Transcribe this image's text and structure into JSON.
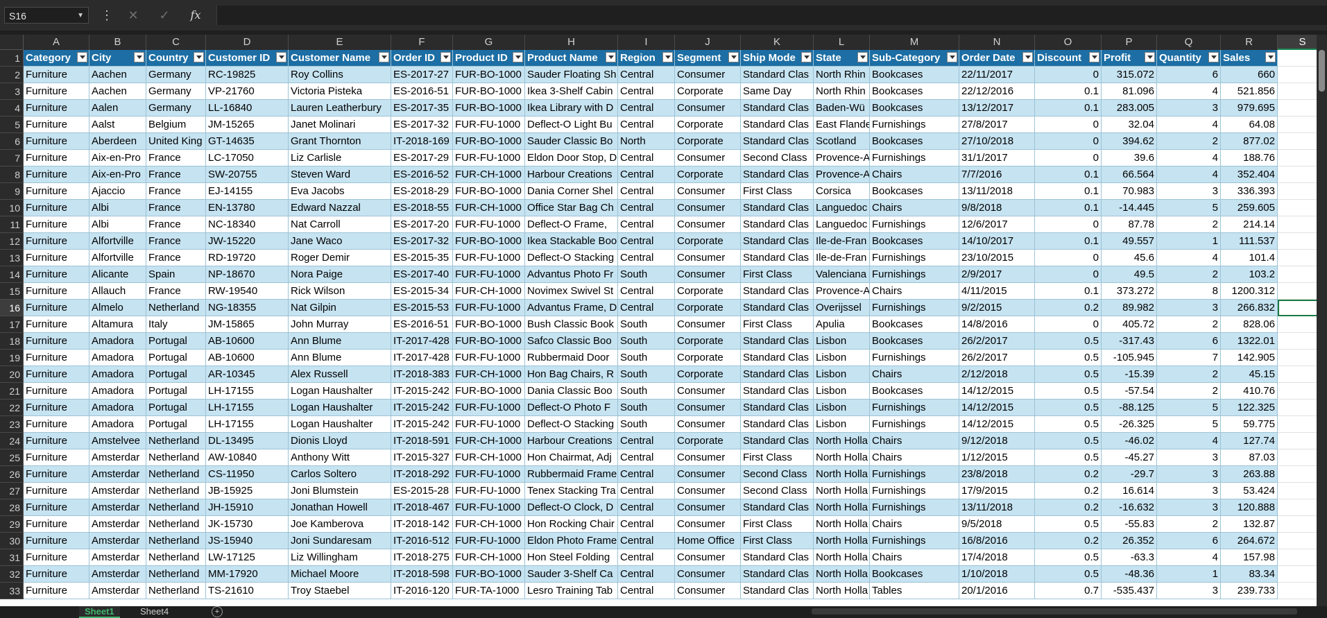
{
  "formula_bar": {
    "name_box": "S16",
    "cancel_icon": "close-icon",
    "enter_icon": "check-icon",
    "function_label": "fx",
    "formula": ""
  },
  "columns": [
    "A",
    "B",
    "C",
    "D",
    "E",
    "F",
    "G",
    "H",
    "I",
    "J",
    "K",
    "L",
    "M",
    "N",
    "O",
    "P",
    "Q",
    "R",
    "S"
  ],
  "selected_column": "S",
  "selected_row": 16,
  "headers": [
    "Category",
    "City",
    "Country",
    "Customer ID",
    "Customer Name",
    "Order ID",
    "Product ID",
    "Product Name",
    "Region",
    "Segment",
    "Ship Mode",
    "State",
    "Sub-Category",
    "Order Date",
    "Discount",
    "Profit",
    "Quantity",
    "Sales"
  ],
  "rows": [
    [
      "Furniture",
      "Aachen",
      "Germany",
      "RC-19825",
      "Roy Collins",
      "ES-2017-27",
      "FUR-BO-1000",
      "Sauder Floating Sh",
      "Central",
      "Consumer",
      "Standard Clas",
      "North Rhin",
      "Bookcases",
      "22/11/2017",
      "0",
      "315.072",
      "6",
      "660"
    ],
    [
      "Furniture",
      "Aachen",
      "Germany",
      "VP-21760",
      "Victoria Pisteka",
      "ES-2016-51",
      "FUR-BO-1000",
      "Ikea 3-Shelf Cabin",
      "Central",
      "Corporate",
      "Same Day",
      "North Rhin",
      "Bookcases",
      "22/12/2016",
      "0.1",
      "81.096",
      "4",
      "521.856"
    ],
    [
      "Furniture",
      "Aalen",
      "Germany",
      "LL-16840",
      "Lauren Leatherbury",
      "ES-2017-35",
      "FUR-BO-1000",
      "Ikea Library with D",
      "Central",
      "Consumer",
      "Standard Clas",
      "Baden-Wü",
      "Bookcases",
      "13/12/2017",
      "0.1",
      "283.005",
      "3",
      "979.695"
    ],
    [
      "Furniture",
      "Aalst",
      "Belgium",
      "JM-15265",
      "Janet Molinari",
      "ES-2017-32",
      "FUR-FU-1000",
      "Deflect-O Light Bu",
      "Central",
      "Corporate",
      "Standard Clas",
      "East Flande",
      "Furnishings",
      "27/8/2017",
      "0",
      "32.04",
      "4",
      "64.08"
    ],
    [
      "Furniture",
      "Aberdeen",
      "United King",
      "GT-14635",
      "Grant Thornton",
      "IT-2018-169",
      "FUR-BO-1000",
      "Sauder Classic Bo",
      "North",
      "Corporate",
      "Standard Clas",
      "Scotland",
      "Bookcases",
      "27/10/2018",
      "0",
      "394.62",
      "2",
      "877.02"
    ],
    [
      "Furniture",
      "Aix-en-Pro",
      "France",
      "LC-17050",
      "Liz Carlisle",
      "ES-2017-29",
      "FUR-FU-1000",
      "Eldon Door Stop, D",
      "Central",
      "Consumer",
      "Second Class",
      "Provence-A",
      "Furnishings",
      "31/1/2017",
      "0",
      "39.6",
      "4",
      "188.76"
    ],
    [
      "Furniture",
      "Aix-en-Pro",
      "France",
      "SW-20755",
      "Steven Ward",
      "ES-2016-52",
      "FUR-CH-1000",
      "Harbour Creations",
      "Central",
      "Corporate",
      "Standard Clas",
      "Provence-A",
      "Chairs",
      "7/7/2016",
      "0.1",
      "66.564",
      "4",
      "352.404"
    ],
    [
      "Furniture",
      "Ajaccio",
      "France",
      "EJ-14155",
      "Eva Jacobs",
      "ES-2018-29",
      "FUR-BO-1000",
      "Dania Corner Shel",
      "Central",
      "Consumer",
      "First Class",
      "Corsica",
      "Bookcases",
      "13/11/2018",
      "0.1",
      "70.983",
      "3",
      "336.393"
    ],
    [
      "Furniture",
      "Albi",
      "France",
      "EN-13780",
      "Edward Nazzal",
      "ES-2018-55",
      "FUR-CH-1000",
      "Office Star Bag Ch",
      "Central",
      "Consumer",
      "Standard Clas",
      "Languedoc",
      "Chairs",
      "9/8/2018",
      "0.1",
      "-14.445",
      "5",
      "259.605"
    ],
    [
      "Furniture",
      "Albi",
      "France",
      "NC-18340",
      "Nat Carroll",
      "ES-2017-20",
      "FUR-FU-1000",
      "Deflect-O Frame,",
      "Central",
      "Consumer",
      "Standard Clas",
      "Languedoc",
      "Furnishings",
      "12/6/2017",
      "0",
      "87.78",
      "2",
      "214.14"
    ],
    [
      "Furniture",
      "Alfortville",
      "France",
      "JW-15220",
      "Jane Waco",
      "ES-2017-32",
      "FUR-BO-1000",
      "Ikea Stackable Boo",
      "Central",
      "Corporate",
      "Standard Clas",
      "Ile-de-Fran",
      "Bookcases",
      "14/10/2017",
      "0.1",
      "49.557",
      "1",
      "111.537"
    ],
    [
      "Furniture",
      "Alfortville",
      "France",
      "RD-19720",
      "Roger Demir",
      "ES-2015-35",
      "FUR-FU-1000",
      "Deflect-O Stacking",
      "Central",
      "Consumer",
      "Standard Clas",
      "Ile-de-Fran",
      "Furnishings",
      "23/10/2015",
      "0",
      "45.6",
      "4",
      "101.4"
    ],
    [
      "Furniture",
      "Alicante",
      "Spain",
      "NP-18670",
      "Nora Paige",
      "ES-2017-40",
      "FUR-FU-1000",
      "Advantus Photo Fr",
      "South",
      "Consumer",
      "First Class",
      "Valenciana",
      "Furnishings",
      "2/9/2017",
      "0",
      "49.5",
      "2",
      "103.2"
    ],
    [
      "Furniture",
      "Allauch",
      "France",
      "RW-19540",
      "Rick Wilson",
      "ES-2015-34",
      "FUR-CH-1000",
      "Novimex Swivel St",
      "Central",
      "Corporate",
      "Standard Clas",
      "Provence-A",
      "Chairs",
      "4/11/2015",
      "0.1",
      "373.272",
      "8",
      "1200.312"
    ],
    [
      "Furniture",
      "Almelo",
      "Netherland",
      "NG-18355",
      "Nat Gilpin",
      "ES-2015-53",
      "FUR-FU-1000",
      "Advantus Frame, D",
      "Central",
      "Corporate",
      "Standard Clas",
      "Overijssel",
      "Furnishings",
      "9/2/2015",
      "0.2",
      "89.982",
      "3",
      "266.832"
    ],
    [
      "Furniture",
      "Altamura",
      "Italy",
      "JM-15865",
      "John Murray",
      "ES-2016-51",
      "FUR-BO-1000",
      "Bush Classic Book",
      "South",
      "Consumer",
      "First Class",
      "Apulia",
      "Bookcases",
      "14/8/2016",
      "0",
      "405.72",
      "2",
      "828.06"
    ],
    [
      "Furniture",
      "Amadora",
      "Portugal",
      "AB-10600",
      "Ann Blume",
      "IT-2017-428",
      "FUR-BO-1000",
      "Safco Classic Boo",
      "South",
      "Corporate",
      "Standard Clas",
      "Lisbon",
      "Bookcases",
      "26/2/2017",
      "0.5",
      "-317.43",
      "6",
      "1322.01"
    ],
    [
      "Furniture",
      "Amadora",
      "Portugal",
      "AB-10600",
      "Ann Blume",
      "IT-2017-428",
      "FUR-FU-1000",
      "Rubbermaid Door",
      "South",
      "Corporate",
      "Standard Clas",
      "Lisbon",
      "Furnishings",
      "26/2/2017",
      "0.5",
      "-105.945",
      "7",
      "142.905"
    ],
    [
      "Furniture",
      "Amadora",
      "Portugal",
      "AR-10345",
      "Alex Russell",
      "IT-2018-383",
      "FUR-CH-1000",
      "Hon Bag Chairs, R",
      "South",
      "Corporate",
      "Standard Clas",
      "Lisbon",
      "Chairs",
      "2/12/2018",
      "0.5",
      "-15.39",
      "2",
      "45.15"
    ],
    [
      "Furniture",
      "Amadora",
      "Portugal",
      "LH-17155",
      "Logan Haushalter",
      "IT-2015-242",
      "FUR-BO-1000",
      "Dania Classic Boo",
      "South",
      "Consumer",
      "Standard Clas",
      "Lisbon",
      "Bookcases",
      "14/12/2015",
      "0.5",
      "-57.54",
      "2",
      "410.76"
    ],
    [
      "Furniture",
      "Amadora",
      "Portugal",
      "LH-17155",
      "Logan Haushalter",
      "IT-2015-242",
      "FUR-FU-1000",
      "Deflect-O Photo F",
      "South",
      "Consumer",
      "Standard Clas",
      "Lisbon",
      "Furnishings",
      "14/12/2015",
      "0.5",
      "-88.125",
      "5",
      "122.325"
    ],
    [
      "Furniture",
      "Amadora",
      "Portugal",
      "LH-17155",
      "Logan Haushalter",
      "IT-2015-242",
      "FUR-FU-1000",
      "Deflect-O Stacking",
      "South",
      "Consumer",
      "Standard Clas",
      "Lisbon",
      "Furnishings",
      "14/12/2015",
      "0.5",
      "-26.325",
      "5",
      "59.775"
    ],
    [
      "Furniture",
      "Amstelvee",
      "Netherland",
      "DL-13495",
      "Dionis Lloyd",
      "IT-2018-591",
      "FUR-CH-1000",
      "Harbour Creations",
      "Central",
      "Corporate",
      "Standard Clas",
      "North Holla",
      "Chairs",
      "9/12/2018",
      "0.5",
      "-46.02",
      "4",
      "127.74"
    ],
    [
      "Furniture",
      "Amsterdar",
      "Netherland",
      "AW-10840",
      "Anthony Witt",
      "IT-2015-327",
      "FUR-CH-1000",
      "Hon Chairmat, Adj",
      "Central",
      "Consumer",
      "First Class",
      "North Holla",
      "Chairs",
      "1/12/2015",
      "0.5",
      "-45.27",
      "3",
      "87.03"
    ],
    [
      "Furniture",
      "Amsterdar",
      "Netherland",
      "CS-11950",
      "Carlos Soltero",
      "IT-2018-292",
      "FUR-FU-1000",
      "Rubbermaid Frame",
      "Central",
      "Consumer",
      "Second Class",
      "North Holla",
      "Furnishings",
      "23/8/2018",
      "0.2",
      "-29.7",
      "3",
      "263.88"
    ],
    [
      "Furniture",
      "Amsterdar",
      "Netherland",
      "JB-15925",
      "Joni Blumstein",
      "ES-2015-28",
      "FUR-FU-1000",
      "Tenex Stacking Tra",
      "Central",
      "Consumer",
      "Second Class",
      "North Holla",
      "Furnishings",
      "17/9/2015",
      "0.2",
      "16.614",
      "3",
      "53.424"
    ],
    [
      "Furniture",
      "Amsterdar",
      "Netherland",
      "JH-15910",
      "Jonathan Howell",
      "IT-2018-467",
      "FUR-FU-1000",
      "Deflect-O Clock, D",
      "Central",
      "Consumer",
      "Standard Clas",
      "North Holla",
      "Furnishings",
      "13/11/2018",
      "0.2",
      "-16.632",
      "3",
      "120.888"
    ],
    [
      "Furniture",
      "Amsterdar",
      "Netherland",
      "JK-15730",
      "Joe Kamberova",
      "IT-2018-142",
      "FUR-CH-1000",
      "Hon Rocking Chair",
      "Central",
      "Consumer",
      "First Class",
      "North Holla",
      "Chairs",
      "9/5/2018",
      "0.5",
      "-55.83",
      "2",
      "132.87"
    ],
    [
      "Furniture",
      "Amsterdar",
      "Netherland",
      "JS-15940",
      "Joni Sundaresam",
      "IT-2016-512",
      "FUR-FU-1000",
      "Eldon Photo Frame",
      "Central",
      "Home Office",
      "First Class",
      "North Holla",
      "Furnishings",
      "16/8/2016",
      "0.2",
      "26.352",
      "6",
      "264.672"
    ],
    [
      "Furniture",
      "Amsterdar",
      "Netherland",
      "LW-17125",
      "Liz Willingham",
      "IT-2018-275",
      "FUR-CH-1000",
      "Hon Steel Folding",
      "Central",
      "Consumer",
      "Standard Clas",
      "North Holla",
      "Chairs",
      "17/4/2018",
      "0.5",
      "-63.3",
      "4",
      "157.98"
    ],
    [
      "Furniture",
      "Amsterdar",
      "Netherland",
      "MM-17920",
      "Michael Moore",
      "IT-2018-598",
      "FUR-BO-1000",
      "Sauder 3-Shelf Ca",
      "Central",
      "Consumer",
      "Standard Clas",
      "North Holla",
      "Bookcases",
      "1/10/2018",
      "0.5",
      "-48.36",
      "1",
      "83.34"
    ],
    [
      "Furniture",
      "Amsterdar",
      "Netherland",
      "TS-21610",
      "Troy Staebel",
      "IT-2016-120",
      "FUR-TA-1000",
      "Lesro Training Tab",
      "Central",
      "Consumer",
      "Standard Clas",
      "North Holla",
      "Tables",
      "20/1/2016",
      "0.7",
      "-535.437",
      "3",
      "239.733"
    ]
  ],
  "sheet_tabs": [
    "Sheet1",
    "Sheet4"
  ],
  "active_sheet": "Sheet1"
}
